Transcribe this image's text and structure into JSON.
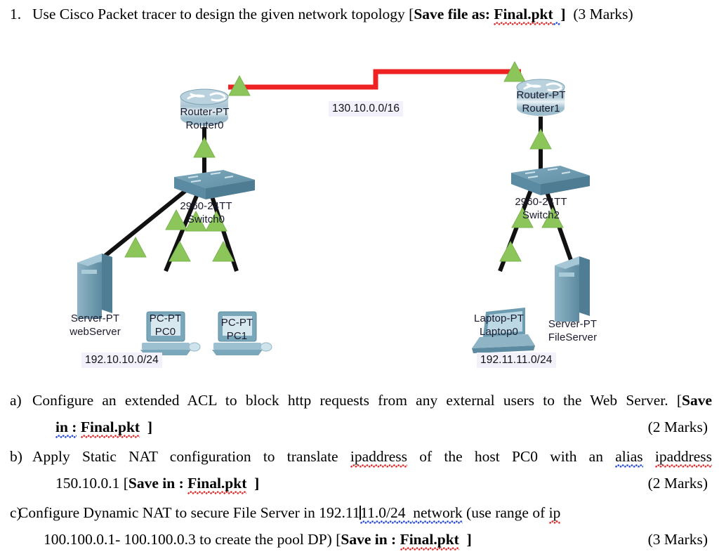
{
  "question": {
    "number": "1.",
    "text_before": "Use Cisco Packet tracer to design the given network topology [",
    "bold_part": "Save file as:",
    "filename": "Final.pkt",
    "bracket_close": "]",
    "marks": "(3 Marks)"
  },
  "subquestions": [
    {
      "label": "a)",
      "line1": "Configure an extended ACL to block http requests from any external users to the Web Server. [",
      "line1_bold_tail": "Save",
      "line2_bold_a": "in :",
      "line2_filename": "Final.pkt",
      "line2_bracket": "]",
      "marks": "(2 Marks)"
    },
    {
      "label": "b)",
      "line1_a": "Apply Static NAT configuration to translate",
      "line1_word1": "ipaddress",
      "line1_b": "of the host PC0 with an",
      "line1_word2": "alias",
      "line1_word3": "ipaddress",
      "line2_ip": "150.10.0.1 [",
      "line2_bold": "Save in :",
      "line2_filename": "Final.pkt",
      "line2_bracket": "]",
      "marks": "(2 Marks)"
    },
    {
      "label": "c)",
      "line1_a": "Configure   Dynamic   NAT   to   secure   File   Server   in   192.11",
      "line1_b": "11.0/24",
      "line1_c": "network",
      "line1_d": "(use   range   of",
      "line1_e": "ip",
      "line2_a": "100.100.0.1-    100.100.0.3 to   create the pool DP) [",
      "line2_bold": "Save in :",
      "line2_filename": "Final.pkt",
      "line2_bracket": "]",
      "marks": "(3 Marks)"
    }
  ],
  "topology": {
    "devices": [
      {
        "id": "router0",
        "icon": "router-icon",
        "model": "Router-PT",
        "name": "Router0"
      },
      {
        "id": "router1",
        "icon": "router-icon",
        "model": "Router-PT",
        "name": "Router1"
      },
      {
        "id": "switch0",
        "icon": "switch-icon",
        "model": "2960-24TT",
        "name": "Switch0"
      },
      {
        "id": "switch2",
        "icon": "switch-icon",
        "model": "2960-24TT",
        "name": "Switch2"
      },
      {
        "id": "webserver",
        "icon": "server-icon",
        "model": "Server-PT",
        "name": "webServer"
      },
      {
        "id": "pc0",
        "icon": "pc-icon",
        "model": "PC-PT",
        "name": "PC0"
      },
      {
        "id": "pc1",
        "icon": "pc-icon",
        "model": "PC-PT",
        "name": "PC1"
      },
      {
        "id": "laptop0",
        "icon": "laptop-icon",
        "model": "Laptop-PT",
        "name": "Laptop0"
      },
      {
        "id": "fileserver",
        "icon": "server-icon",
        "model": "Server-PT",
        "name": "FileServer"
      }
    ],
    "network_labels": [
      {
        "id": "wan",
        "text": "130.10.0.0/16"
      },
      {
        "id": "left-lan",
        "text": "192.10.10.0/24"
      },
      {
        "id": "right-lan",
        "text": "192.11.11.0/24"
      }
    ],
    "colors": {
      "serial_link": "#ee2222",
      "ethernet_link": "#111111",
      "link_status_up": "#8cc65a",
      "device_body": "#6d9bb0",
      "label_bg": "#f2f0fb"
    }
  }
}
